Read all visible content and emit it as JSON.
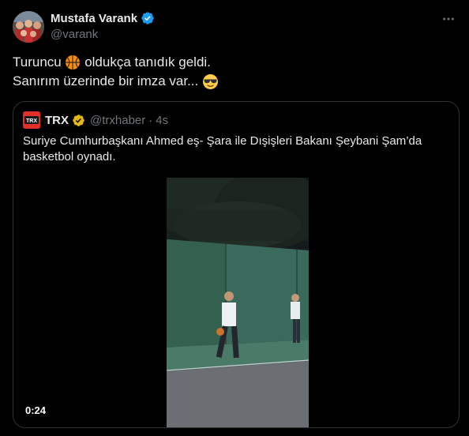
{
  "author": {
    "name": "Mustafa Varank",
    "handle": "@varank"
  },
  "tweet": {
    "line1_before": "Turuncu ",
    "line1_after": " oldukça tanıdık geldi.",
    "line2": "Sanırım üzerinde bir imza var...",
    "emoji_1": "basketball-emoji",
    "emoji_2": "sunglasses-emoji"
  },
  "quote": {
    "logo_text": "TRX",
    "name": "TRX",
    "handle": "@trxhaber",
    "separator": "·",
    "time": "4s",
    "text": "Suriye Cumhurbaşkanı Ahmed eş- Şara ile Dışişleri Bakanı Şeybani Şam’da basketbol oynadı.",
    "video_duration": "0:24"
  },
  "colors": {
    "background": "#000000",
    "text_primary": "#e7e9ea",
    "text_secondary": "#71767b",
    "border": "#2f3336",
    "verified_blue": "#1d9bf0",
    "verified_gold": "#e2b719",
    "trx_red": "#e0302a"
  }
}
